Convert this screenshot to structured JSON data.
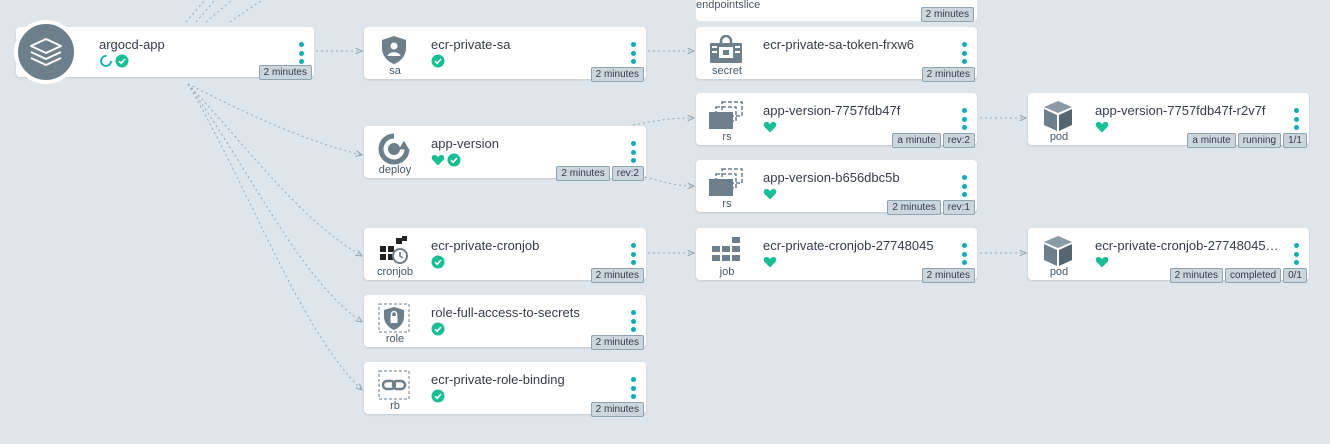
{
  "colors": {
    "background": "#dee6eb",
    "healthy": "#18be94",
    "accent": "#0dadb8",
    "tag_bg": "#ccd6dd",
    "icon_gray": "#6d7f8b"
  },
  "top_fragment": {
    "kind": "endpointslice",
    "tag": "2 minutes"
  },
  "app": {
    "name": "argocd-app",
    "age": "2 minutes",
    "status_icons": [
      "sync-progress-icon",
      "synced-check-icon"
    ]
  },
  "nodes": {
    "sa": {
      "kind": "sa",
      "name": "ecr-private-sa",
      "tags": [
        "2 minutes"
      ]
    },
    "secret": {
      "kind": "secret",
      "name": "ecr-private-sa-token-frxw6",
      "tags": [
        "2 minutes"
      ]
    },
    "deploy": {
      "kind": "deploy",
      "name": "app-version",
      "tags": [
        "2 minutes",
        "rev:2"
      ]
    },
    "rs1": {
      "kind": "rs",
      "name": "app-version-7757fdb47f",
      "tags": [
        "a minute",
        "rev:2"
      ]
    },
    "pod1": {
      "kind": "pod",
      "name": "app-version-7757fdb47f-r2v7f",
      "tags": [
        "a minute",
        "running",
        "1/1"
      ]
    },
    "rs2": {
      "kind": "rs",
      "name": "app-version-b656dbc5b",
      "tags": [
        "2 minutes",
        "rev:1"
      ]
    },
    "cronjob": {
      "kind": "cronjob",
      "name": "ecr-private-cronjob",
      "tags": [
        "2 minutes"
      ]
    },
    "job": {
      "kind": "job",
      "name": "ecr-private-cronjob-27748045",
      "tags": [
        "2 minutes"
      ]
    },
    "pod2": {
      "kind": "pod",
      "name": "ecr-private-cronjob-27748045…",
      "tags": [
        "2 minutes",
        "completed",
        "0/1"
      ]
    },
    "role": {
      "kind": "role",
      "name": "role-full-access-to-secrets",
      "tags": [
        "2 minutes"
      ]
    },
    "rb": {
      "kind": "rb",
      "name": "ecr-private-role-binding",
      "tags": [
        "2 minutes"
      ]
    }
  }
}
